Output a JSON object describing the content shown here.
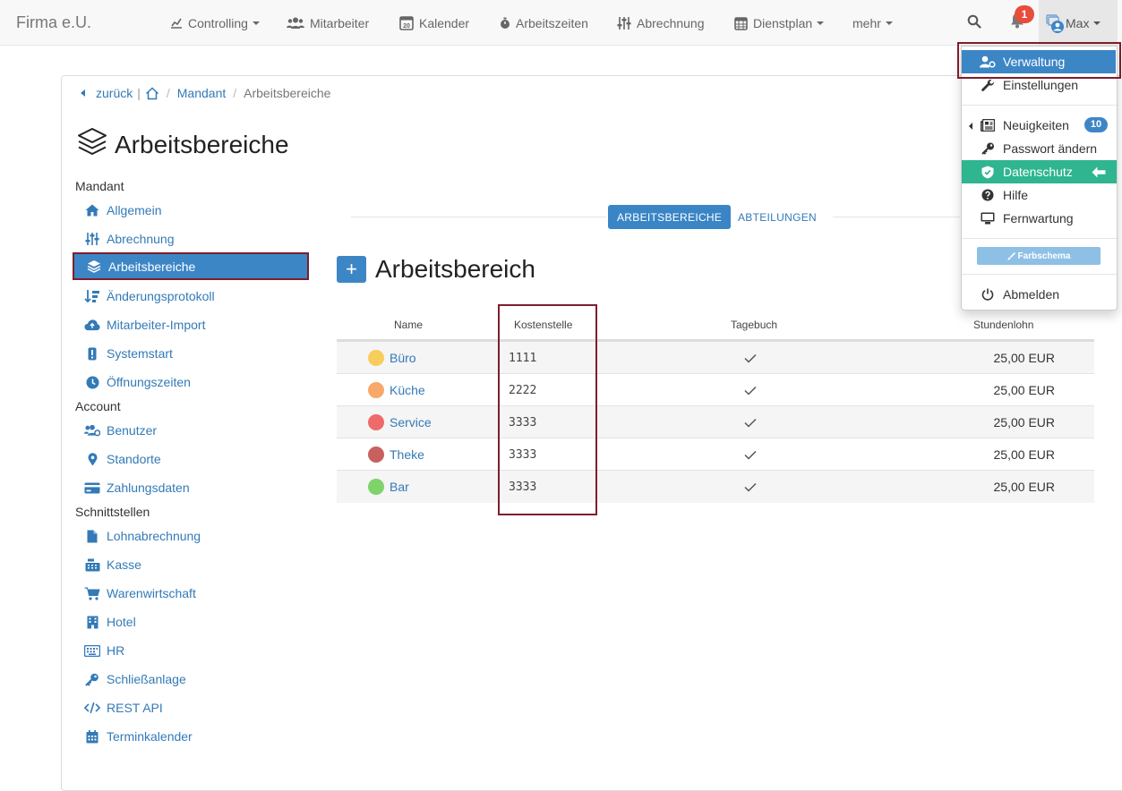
{
  "navbar": {
    "brand": "Firma e.U.",
    "items": [
      {
        "label": "Controlling",
        "icon": "chart-line-icon",
        "dropdown": true
      },
      {
        "label": "Mitarbeiter",
        "icon": "users-icon",
        "dropdown": false
      },
      {
        "label": "Kalender",
        "icon": "calendar-icon",
        "dropdown": false
      },
      {
        "label": "Arbeitszeiten",
        "icon": "stopwatch-icon",
        "dropdown": false
      },
      {
        "label": "Abrechnung",
        "icon": "sliders-icon",
        "dropdown": false
      },
      {
        "label": "Dienstplan",
        "icon": "calendar-grid-icon",
        "dropdown": true
      },
      {
        "label": "mehr",
        "icon": "",
        "dropdown": true
      }
    ],
    "notification_count": "1",
    "user_label": "Max",
    "calendar_day": "20"
  },
  "breadcrumb": {
    "back": "zurück",
    "separator": "|",
    "crumb_sep": "/",
    "mandant": "Mandant",
    "current": "Arbeitsbereiche"
  },
  "page_title": "Arbeitsbereiche",
  "sidebar": {
    "groups": [
      {
        "header": "Mandant",
        "items": [
          {
            "label": "Allgemein",
            "icon": "home-icon"
          },
          {
            "label": "Abrechnung",
            "icon": "sliders-icon"
          },
          {
            "label": "Arbeitsbereiche",
            "icon": "layers-icon",
            "active": true
          },
          {
            "label": "Änderungsprotokoll",
            "icon": "sort-icon"
          },
          {
            "label": "Mitarbeiter-Import",
            "icon": "cloud-upload-icon"
          },
          {
            "label": "Systemstart",
            "icon": "exclamation-icon"
          },
          {
            "label": "Öffnungszeiten",
            "icon": "clock-icon"
          }
        ]
      },
      {
        "header": "Account",
        "items": [
          {
            "label": "Benutzer",
            "icon": "users-cog-icon"
          },
          {
            "label": "Standorte",
            "icon": "map-marker-icon"
          },
          {
            "label": "Zahlungsdaten",
            "icon": "credit-card-icon"
          }
        ]
      },
      {
        "header": "Schnittstellen",
        "items": [
          {
            "label": "Lohnabrechnung",
            "icon": "file-icon"
          },
          {
            "label": "Kasse",
            "icon": "cash-register-icon"
          },
          {
            "label": "Warenwirtschaft",
            "icon": "cart-icon"
          },
          {
            "label": "Hotel",
            "icon": "hotel-icon"
          },
          {
            "label": "HR",
            "icon": "keyboard-icon"
          },
          {
            "label": "Schließanlage",
            "icon": "key-icon"
          },
          {
            "label": "REST API",
            "icon": "code-icon"
          },
          {
            "label": "Terminkalender",
            "icon": "calendar-icon"
          }
        ]
      }
    ]
  },
  "tabs": [
    {
      "label": "ARBEITSBEREICHE",
      "active": true
    },
    {
      "label": "ABTEILUNGEN",
      "active": false
    }
  ],
  "section_title": "Arbeitsbereich",
  "add_button": "+",
  "table": {
    "headers": [
      "Name",
      "Kostenstelle",
      "Tagebuch",
      "Stundenlohn"
    ],
    "rows": [
      {
        "name": "Büro",
        "color": "#f7cd5e",
        "kostenstelle": "1111",
        "tagebuch": true,
        "stundenlohn": "25,00 EUR"
      },
      {
        "name": "Küche",
        "color": "#f9a86b",
        "kostenstelle": "2222",
        "tagebuch": true,
        "stundenlohn": "25,00 EUR"
      },
      {
        "name": "Service",
        "color": "#ef6b6b",
        "kostenstelle": "3333",
        "tagebuch": true,
        "stundenlohn": "25,00 EUR"
      },
      {
        "name": "Theke",
        "color": "#c7615f",
        "kostenstelle": "3333",
        "tagebuch": true,
        "stundenlohn": "25,00 EUR"
      },
      {
        "name": "Bar",
        "color": "#7ed36b",
        "kostenstelle": "3333",
        "tagebuch": true,
        "stundenlohn": "25,00 EUR"
      }
    ]
  },
  "dropdown": {
    "verwaltung": "Verwaltung",
    "einstellungen": "Einstellungen",
    "neuigkeiten": "Neuigkeiten",
    "neuigkeiten_count": "10",
    "passwort": "Passwort ändern",
    "datenschutz": "Datenschutz",
    "hilfe": "Hilfe",
    "fernwartung": "Fernwartung",
    "farbschema": "Farbschema",
    "abmelden": "Abmelden"
  },
  "colors": {
    "primary": "#3d86c6",
    "success": "#2fb58f",
    "danger": "#e74c3c",
    "highlight": "#7d1e2c",
    "link": "#337ab7"
  }
}
